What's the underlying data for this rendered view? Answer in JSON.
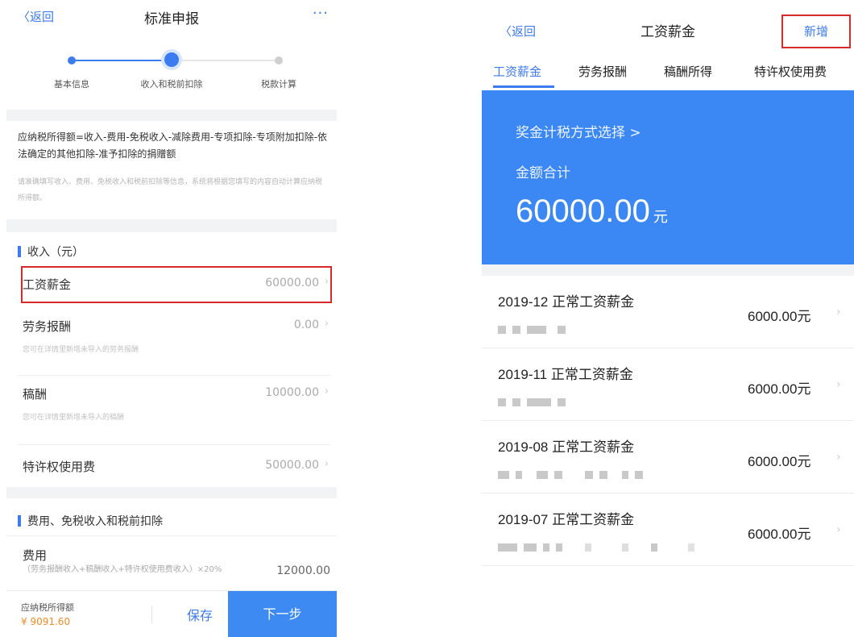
{
  "left": {
    "nav": {
      "back": "〈返回",
      "title": "标准申报",
      "more": "···"
    },
    "steps": [
      {
        "label": "基本信息",
        "state": "done"
      },
      {
        "label": "收入和税前扣除",
        "state": "current"
      },
      {
        "label": "税款计算",
        "state": "todo"
      }
    ],
    "formula": "应纳税所得额=收入-费用-免税收入-减除费用-专项扣除-专项附加扣除-依法确定的其他扣除-准予扣除的捐赠额",
    "hint": "请准确填写收入、费用、免税收入和税前扣除等信息，系统将根据您填写的内容自动计算应纳税所得额。",
    "income_section": "收入（元）",
    "income_rows": [
      {
        "label": "工资薪金",
        "value": "60000.00",
        "sub": ""
      },
      {
        "label": "劳务报酬",
        "value": "0.00",
        "sub": "您可在详情里新增未导入的劳务报酬"
      },
      {
        "label": "稿酬",
        "value": "10000.00",
        "sub": "您可在详情里新增未导入的稿酬"
      },
      {
        "label": "特许权使用费",
        "value": "50000.00",
        "sub": ""
      }
    ],
    "fee_section": "费用、免税收入和税前扣除",
    "fee": {
      "label": "费用",
      "desc": "（劳务报酬收入+稿酬收入+特许权使用费收入）×20%",
      "value": "12000.00"
    },
    "bottom": {
      "label": "应纳税所得额",
      "value": "¥ 9091.60",
      "save": "保存",
      "next": "下一步"
    }
  },
  "right": {
    "nav": {
      "back": "〈返回",
      "title": "工资薪金",
      "add": "新增"
    },
    "tabs": [
      "工资薪金",
      "劳务报酬",
      "稿酬所得",
      "特许权使用费"
    ],
    "banner": {
      "link": "奖金计税方式选择 >",
      "label": "金额合计",
      "amount": "60000.00",
      "unit": "元"
    },
    "entries": [
      {
        "title": "2019-12 正常工资薪金",
        "amount": "6000.00元"
      },
      {
        "title": "2019-11 正常工资薪金",
        "amount": "6000.00元"
      },
      {
        "title": "2019-08 正常工资薪金",
        "amount": "6000.00元"
      },
      {
        "title": "2019-07 正常工资薪金",
        "amount": "6000.00元"
      }
    ]
  },
  "colors": {
    "accent": "#3d7bf0",
    "banner": "#3b88f5",
    "highlight": "#d72a2a",
    "amount": "#f08a24"
  }
}
